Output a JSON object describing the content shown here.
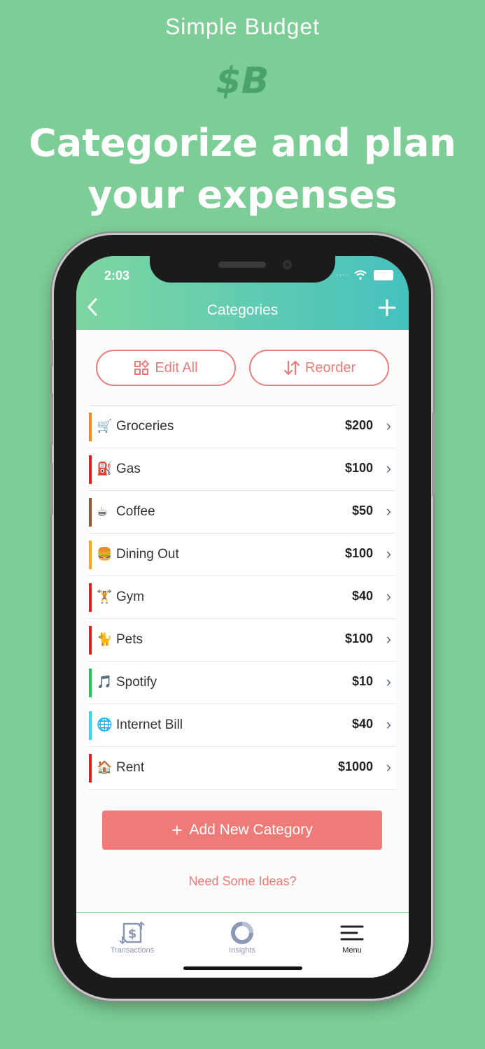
{
  "promo": {
    "app_name": "Simple Budget",
    "logo_text": "$B",
    "headline_line1": "Categorize and plan",
    "headline_line2": "your expenses"
  },
  "status_bar": {
    "time": "2:03"
  },
  "nav": {
    "back_icon": "chevron-left-icon",
    "title": "Categories",
    "add_icon": "plus-icon"
  },
  "actions": {
    "edit_all": "Edit All",
    "reorder": "Reorder"
  },
  "categories": [
    {
      "emoji": "🛒",
      "name": "Groceries",
      "amount": "$200",
      "color": "#f5871f"
    },
    {
      "emoji": "⛽",
      "name": "Gas",
      "amount": "$100",
      "color": "#e02020"
    },
    {
      "emoji": "☕",
      "name": "Coffee",
      "amount": "$50",
      "color": "#8a5a36"
    },
    {
      "emoji": "🍔",
      "name": "Dining Out",
      "amount": "$100",
      "color": "#f7a81b"
    },
    {
      "emoji": "🏋",
      "name": "Gym",
      "amount": "$40",
      "color": "#e02020"
    },
    {
      "emoji": "🐈",
      "name": "Pets",
      "amount": "$100",
      "color": "#e02020"
    },
    {
      "emoji": "🎵",
      "name": "Spotify",
      "amount": "$10",
      "color": "#1ec755"
    },
    {
      "emoji": "🌐",
      "name": "Internet Bill",
      "amount": "$40",
      "color": "#35d5ef"
    },
    {
      "emoji": "🏠",
      "name": "Rent",
      "amount": "$1000",
      "color": "#e02020"
    }
  ],
  "add_category": "Add New Category",
  "ideas_link": "Need Some Ideas?",
  "tabs": [
    {
      "label": "Transactions",
      "icon": "dollar-exchange-icon"
    },
    {
      "label": "Insights",
      "icon": "donut-chart-icon"
    },
    {
      "label": "Menu",
      "icon": "menu-icon"
    }
  ]
}
